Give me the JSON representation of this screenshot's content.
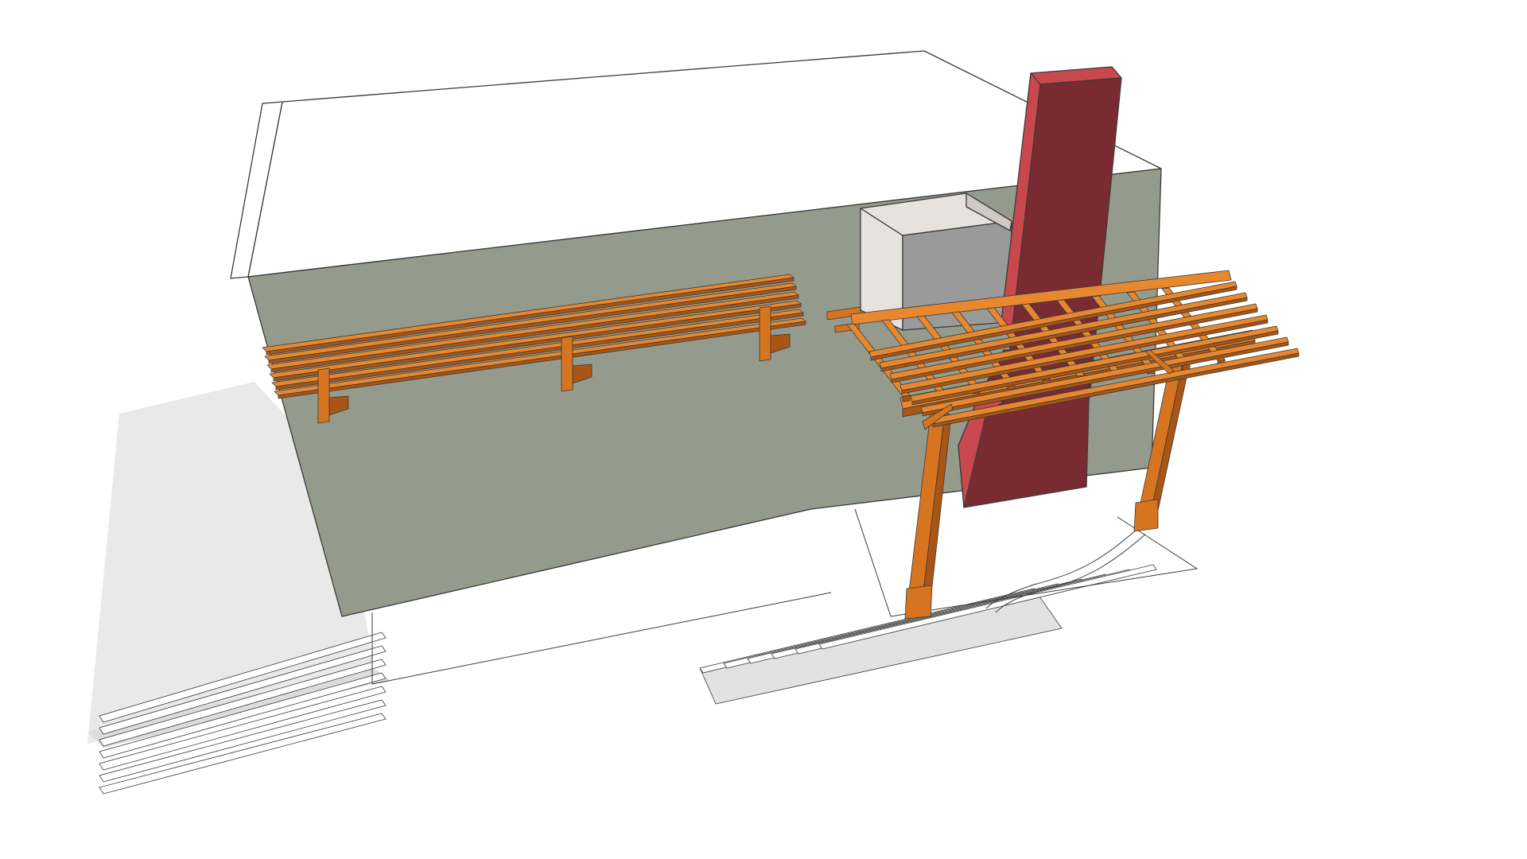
{
  "colors": {
    "background": "#ffffff",
    "roof_top": "#ffffff",
    "wall_front": "#959b8c",
    "wall_side": "#8a9083",
    "chimney_front": "#c8484e",
    "chimney_side": "#7a2b31",
    "box_front": "#9a9a9a",
    "box_light": "#e6e3de",
    "wood_light": "#e8882e",
    "wood_mid": "#d77420",
    "wood_dark": "#a95515",
    "shadow": "#e6e6e6",
    "outline": "#3a3a3a"
  }
}
